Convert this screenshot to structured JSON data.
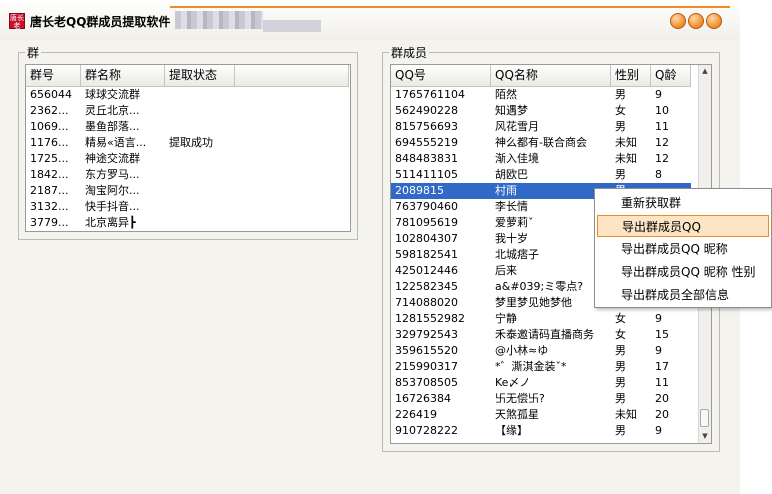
{
  "window": {
    "title": "唐长老QQ群成员提取软件",
    "app_icon_text": "唐长老",
    "accent_color": "#f08a24"
  },
  "groups_panel": {
    "label": "群",
    "columns": [
      "群号",
      "群名称",
      "提取状态",
      ""
    ],
    "rows": [
      {
        "id": "656044",
        "name": "球球交流群",
        "status": ""
      },
      {
        "id": "2362...",
        "name": "灵丘北京...",
        "status": ""
      },
      {
        "id": "1069...",
        "name": "墨鱼部落...",
        "status": ""
      },
      {
        "id": "1176...",
        "name": "精易«语言...",
        "status": "提取成功"
      },
      {
        "id": "1725...",
        "name": "神途交流群",
        "status": ""
      },
      {
        "id": "1842...",
        "name": "东方罗马...",
        "status": ""
      },
      {
        "id": "2187...",
        "name": "淘宝阿尔...",
        "status": ""
      },
      {
        "id": "3132...",
        "name": "快手抖音...",
        "status": ""
      },
      {
        "id": "3779...",
        "name": "北京离异┣",
        "status": ""
      }
    ]
  },
  "members_panel": {
    "label": "群成员",
    "columns": [
      "QQ号",
      "QQ名称",
      "性别",
      "Q龄"
    ],
    "selected_index": 6,
    "rows": [
      {
        "qq": "1765761104",
        "name": "陌然",
        "gender": "男",
        "age": "9"
      },
      {
        "qq": "562490228",
        "name": "知遇梦",
        "gender": "女",
        "age": "10"
      },
      {
        "qq": "815756693",
        "name": "风花雪月",
        "gender": "男",
        "age": "11"
      },
      {
        "qq": "694555219",
        "name": "神么都有-联合商会",
        "gender": "未知",
        "age": "12"
      },
      {
        "qq": "848483831",
        "name": "渐入佳境",
        "gender": "未知",
        "age": "12"
      },
      {
        "qq": "511411105",
        "name": "胡欧巴",
        "gender": "男",
        "age": "8"
      },
      {
        "qq": "2089815",
        "name": "村雨",
        "gender": "男",
        "age": ""
      },
      {
        "qq": "763790460",
        "name": "李长情",
        "gender": "",
        "age": ""
      },
      {
        "qq": "781095619",
        "name": "爱萝莉ˇ",
        "gender": "",
        "age": ""
      },
      {
        "qq": "102804307",
        "name": "我十岁",
        "gender": "",
        "age": ""
      },
      {
        "qq": "598182541",
        "name": "北城痞子",
        "gender": "",
        "age": ""
      },
      {
        "qq": "425012446",
        "name": "后来",
        "gender": "",
        "age": ""
      },
      {
        "qq": "122582345",
        "name": "a&#039;ミ零点?",
        "gender": "",
        "age": ""
      },
      {
        "qq": "714088020",
        "name": "梦里梦见她梦他",
        "gender": "",
        "age": ""
      },
      {
        "qq": "1281552982",
        "name": "宁静",
        "gender": "女",
        "age": "9"
      },
      {
        "qq": "329792543",
        "name": "禾泰邀请码直播商务",
        "gender": "女",
        "age": "15"
      },
      {
        "qq": "359615520",
        "name": "@小林≈ゆ",
        "gender": "男",
        "age": "9"
      },
      {
        "qq": "215990317",
        "name": "*゛澌淇金装ˇ*",
        "gender": "男",
        "age": "17"
      },
      {
        "qq": "853708505",
        "name": "Ke〆ノ",
        "gender": "男",
        "age": "11"
      },
      {
        "qq": "16726384",
        "name": "卐无偿卐?",
        "gender": "男",
        "age": "20"
      },
      {
        "qq": "226419",
        "name": "天煞孤星",
        "gender": "未知",
        "age": "20"
      },
      {
        "qq": "910728222",
        "name": "【缘】",
        "gender": "男",
        "age": "9"
      }
    ]
  },
  "context_menu": {
    "active_index": 1,
    "items": [
      "重新获取群",
      "导出群成员QQ",
      "导出群成员QQ 昵称",
      "导出群成员QQ 昵称 性别",
      "导出群成员全部信息"
    ]
  }
}
